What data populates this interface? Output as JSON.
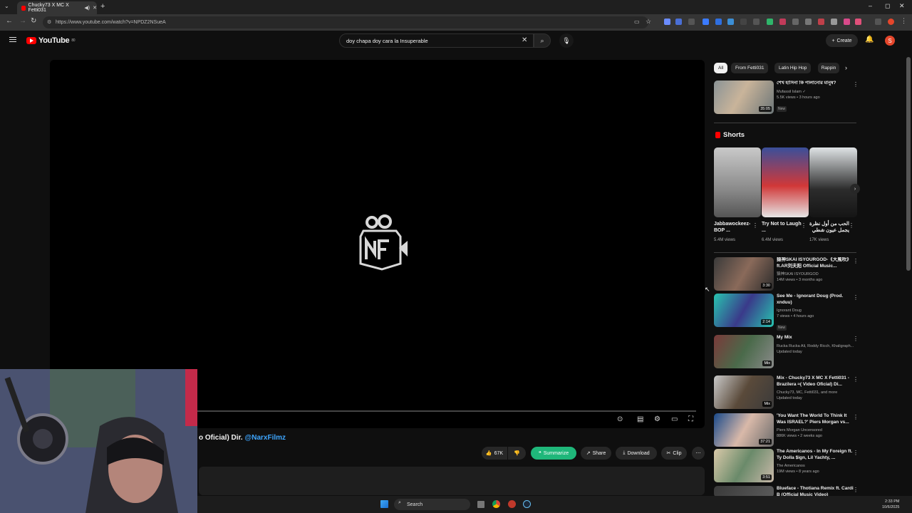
{
  "browser": {
    "tab_title": "Chucky73 X MC X Fetti031",
    "url": "https://www.youtube.com/watch?v=NPDZ2NSueA",
    "window_controls": [
      "–",
      "◻",
      "✕"
    ]
  },
  "youtube": {
    "logo_text": "YouTube",
    "logo_super": "80",
    "search_query": "doy chapa doy cara la Insuperable",
    "create_label": "Create",
    "avatar_letter": "S"
  },
  "video": {
    "title_fragment": "o Oficial) Dir.",
    "title_link": "@NarxFilmz",
    "likes": "67K",
    "summarize_label": "Summarize",
    "share_label": "Share",
    "download_label": "Download",
    "clip_label": "Clip",
    "progress_fraction": 0.01
  },
  "chips": [
    "All",
    "From Fetti031",
    "Latin Hip Hop",
    "Rappin"
  ],
  "top_video": {
    "title": "শেখ হাসিনা কি পালানোর মানুষ?",
    "channel": "Mufassil Islam",
    "meta": "5.5K views • 3 hours ago",
    "badge": "New",
    "duration": "35:05"
  },
  "shorts": {
    "heading": "Shorts",
    "items": [
      {
        "title": "Jabbawockeez- BOP ...",
        "views": "5.4M views"
      },
      {
        "title": "Try Not to Laugh ...",
        "views": "6.4M views"
      },
      {
        "title": "الحب من أول نظرة يجمل عيون شطي",
        "views": "17K views"
      }
    ]
  },
  "videos": [
    {
      "title": "猿神SKAI ISYOURGOD-《大風吹》ft.AR刘夫阳 Official Music...",
      "channel": "猿神SKAI ISYOURGOD",
      "meta": "14M views • 3 months ago",
      "badge": "",
      "duration": "3:30"
    },
    {
      "title": "See Me - Ignorant Doug (Prod. xnduu)",
      "channel": "Ignorant Doug",
      "meta": "7 views • 4 hours ago",
      "badge": "New",
      "duration": "2:14"
    },
    {
      "title": "My Mix",
      "channel": "Rucka Rucka Ali, Roddy Ricch, Khaligraph...",
      "meta": "Updated today",
      "badge": "",
      "duration": "Mix"
    },
    {
      "title": "Mix - Chucky73 X MC X Fetti031 - Brazilera ≈( Video Oficial) Di...",
      "channel": "Chucky73, MC, Fetti031, and more",
      "meta": "Updated today",
      "badge": "",
      "duration": "Mix"
    },
    {
      "title": "'You Want The World To Think It Was ISRAEL?' Piers Morgan vs...",
      "channel": "Piers Morgan Uncensored",
      "meta": "886K views • 2 weeks ago",
      "badge": "",
      "duration": "37:21"
    },
    {
      "title": "The Americanos - In My Foreign ft. Ty Dolla $ign, Lil Yachty, ...",
      "channel": "The Americanos",
      "meta": "19M views • 8 years ago",
      "badge": "",
      "duration": "3:51"
    },
    {
      "title": "Blueface - Thotiana Remix ft. Cardi B (Official Music Video)",
      "channel": "",
      "meta": "",
      "badge": "",
      "duration": ""
    }
  ],
  "taskbar": {
    "search_label": "Search",
    "time": "2:33 PM",
    "date": "10/6/2025"
  }
}
